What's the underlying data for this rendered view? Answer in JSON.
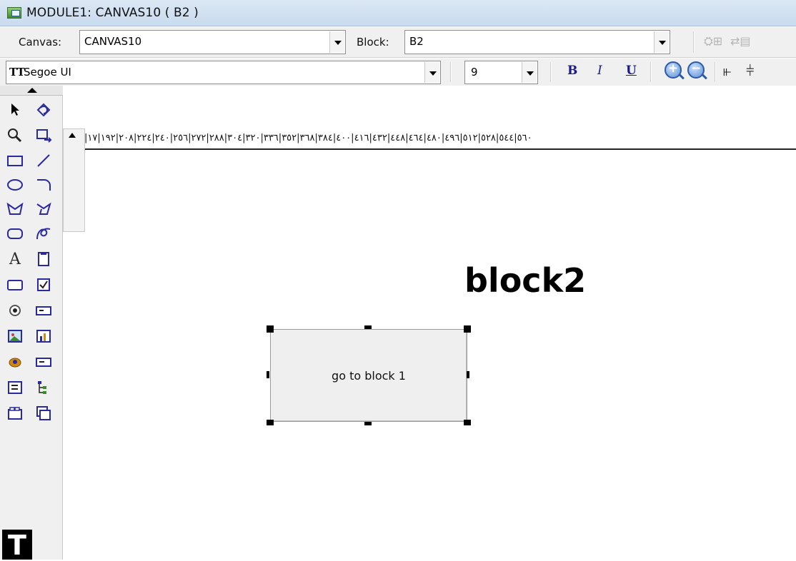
{
  "window": {
    "title": "MODULE1: CANVAS10 ( B2 )"
  },
  "toolbar": {
    "canvas_label": "Canvas:",
    "canvas_value": "CANVAS10",
    "block_label": "Block:",
    "block_value": "B2"
  },
  "font_toolbar": {
    "font_icon": "TT",
    "font_value": "Segoe UI",
    "size_value": "9",
    "bold_label": "B",
    "italic_label": "I",
    "underline_label": "U"
  },
  "ruler": {
    "text": "|٥٦٠|٥٤٤|٥٢٨|٥١٢|٤٩٦|٤٨٠|٤٦٤|٤٤٨|٤٣٢|٤١٦|٤٠٠|٣٨٤|٣٦٨|٣٥٢|٣٣٦|٣٢٠|٣٠٤|٢٨٨|٢٧٢|٢٥٦|٢٤٠|٢٢٤|٢٠٨|١٩٢|١٧"
  },
  "canvas": {
    "block_title": "block2",
    "button_label": "go to block 1"
  },
  "palette": {
    "text_tool_glyph": "A",
    "big_tool_glyph": "T"
  }
}
